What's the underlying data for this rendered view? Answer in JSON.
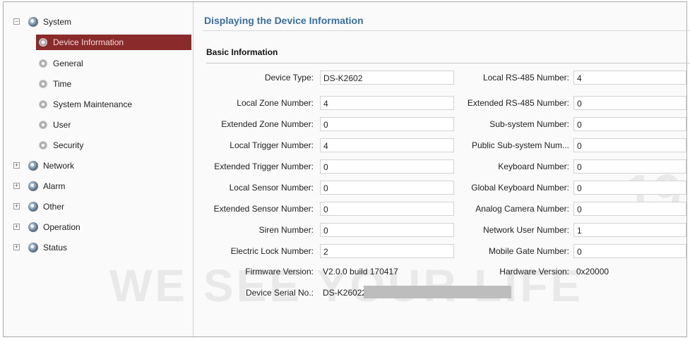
{
  "sidebar": {
    "items": [
      {
        "label": "System",
        "expander": "−",
        "icon": "gear-icon"
      },
      {
        "label": "Device Information",
        "icon": "gear-icon",
        "selected": true
      },
      {
        "label": "General",
        "icon": "gear-icon"
      },
      {
        "label": "Time",
        "icon": "gear-icon"
      },
      {
        "label": "System Maintenance",
        "icon": "gear-icon"
      },
      {
        "label": "User",
        "icon": "gear-icon"
      },
      {
        "label": "Security",
        "icon": "gear-icon"
      },
      {
        "label": "Network",
        "expander": "+",
        "icon": "gear-icon"
      },
      {
        "label": "Alarm",
        "expander": "+",
        "icon": "gear-icon"
      },
      {
        "label": "Other",
        "expander": "+",
        "icon": "gear-icon"
      },
      {
        "label": "Operation",
        "expander": "+",
        "icon": "gear-icon"
      },
      {
        "label": "Status",
        "expander": "+",
        "icon": "gear-icon"
      }
    ]
  },
  "main": {
    "title": "Displaying the Device Information",
    "section": "Basic Information",
    "left_fields": [
      {
        "label": "Device Type:",
        "value": "DS-K2602"
      },
      {
        "label": "Local Zone Number:",
        "value": "4"
      },
      {
        "label": "Extended Zone Number:",
        "value": "0"
      },
      {
        "label": "Local Trigger Number:",
        "value": "4"
      },
      {
        "label": "Extended Trigger Number:",
        "value": "0"
      },
      {
        "label": "Local Sensor Number:",
        "value": "0"
      },
      {
        "label": "Extended Sensor Number:",
        "value": "0"
      },
      {
        "label": "Siren Number:",
        "value": "0"
      },
      {
        "label": "Electric Lock Number:",
        "value": "2"
      }
    ],
    "right_fields": [
      {
        "label": "Local RS-485 Number:",
        "value": "4"
      },
      {
        "label": "Extended RS-485 Number:",
        "value": "0"
      },
      {
        "label": "Sub-system Number:",
        "value": "0"
      },
      {
        "label": "Public Sub-system Num...",
        "value": "0"
      },
      {
        "label": "Keyboard Number:",
        "value": "0"
      },
      {
        "label": "Global Keyboard Number:",
        "value": "0"
      },
      {
        "label": "Analog Camera Number:",
        "value": "0"
      },
      {
        "label": "Network User Number:",
        "value": "1"
      },
      {
        "label": "Mobile Gate Number:",
        "value": "0"
      }
    ],
    "firmware": {
      "label": "Firmware Version:",
      "value": "V2.0.0 build 170417"
    },
    "hardware": {
      "label": "Hardware Version:",
      "value": "0x20000"
    },
    "serial": {
      "label": "Device Serial No.:",
      "value": "DS-K26022"
    }
  },
  "watermark": {
    "text": "WE SEE YOUR LIFE",
    "year": "19"
  },
  "colors": {
    "accent": "#3b6e9f",
    "selected_bg": "#8a2a2a"
  }
}
